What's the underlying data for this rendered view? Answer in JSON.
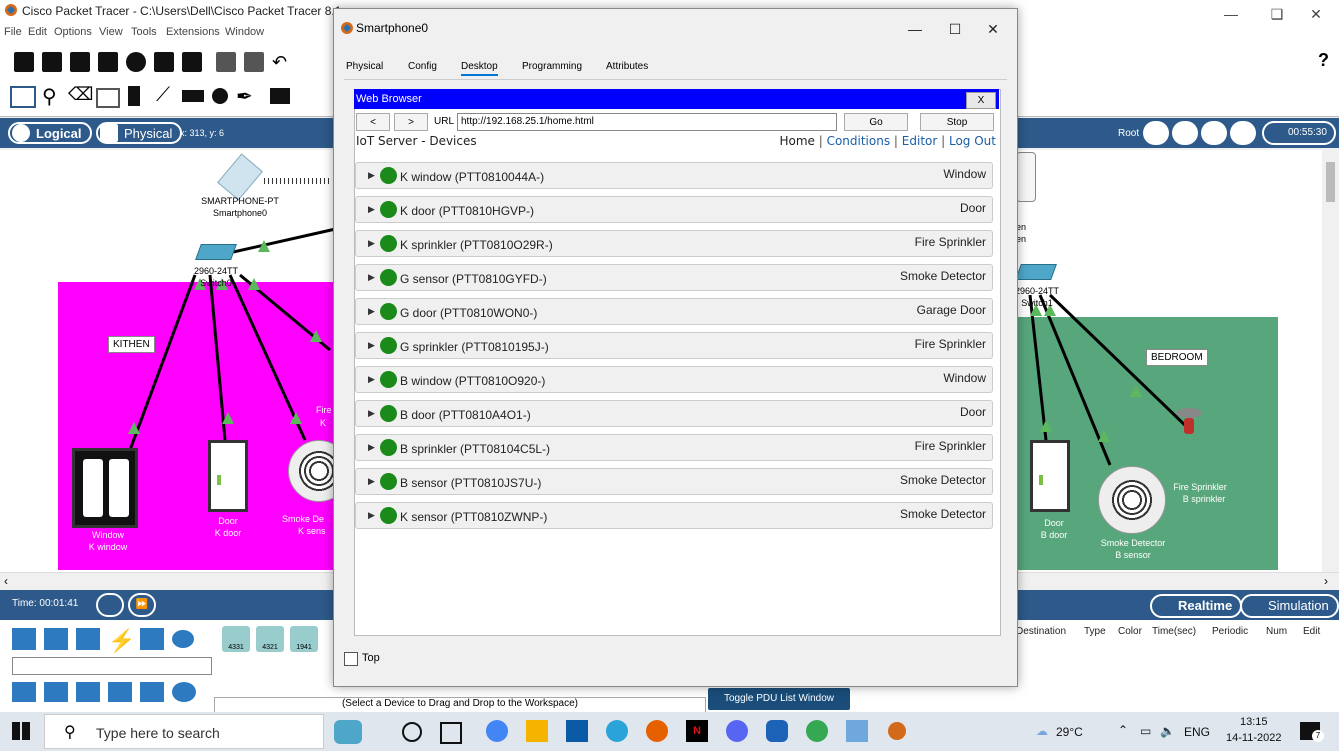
{
  "app": {
    "title": "Cisco Packet Tracer - C:\\Users\\Dell\\Cisco Packet Tracer 8.1.",
    "menu": [
      "File",
      "Edit",
      "Options",
      "View",
      "Tools",
      "Extensions",
      "Window"
    ],
    "coords": "x: 313, y: 6",
    "logical_label": "Logical",
    "physical_label": "Physical",
    "root_label": "Root",
    "clock": "00:55:30",
    "help": "?"
  },
  "workspace": {
    "smartphone_label1": "SMARTPHONE-PT",
    "smartphone_label2": "Smartphone0",
    "switch_left_label1": "2960-24TT",
    "switch_left_label2": "Switch0",
    "switch_right_label1": "2960-24TT",
    "switch_right_label2": "Switch1",
    "kitchen_label": "KITHEN",
    "bedroom_label": "BEDROOM",
    "k_window_label1": "Window",
    "k_window_label2": "K window",
    "k_door_label1": "Door",
    "k_door_label2": "K door",
    "k_smoke_label1": "Smoke De",
    "k_smoke_label2": "K sens",
    "k_fire_label1": "Fire",
    "k_fire_label2": "K",
    "b_door_label1": "Door",
    "b_door_label2": "B door",
    "b_smoke_label1": "Smoke Detector",
    "b_smoke_label2": "B sensor",
    "b_fire_label1": "Fire Sprinkler",
    "b_fire_label2": "B sprinkler",
    "right_partial1": "en",
    "right_partial2": "en"
  },
  "bottom": {
    "time": "Time: 00:01:41",
    "realtime": "Realtime",
    "simulation": "Simulation",
    "status": "(Select a Device to Drag and Drop to the Workspace)",
    "toggle_pdu": "Toggle PDU List Window",
    "pdu_headers": [
      "Destination",
      "Type",
      "Color",
      "Time(sec)",
      "Periodic",
      "Num",
      "Edit"
    ],
    "models": [
      "4331",
      "4321",
      "1941"
    ]
  },
  "taskbar": {
    "search_placeholder": "Type here to search",
    "weather": "29°C",
    "lang": "ENG",
    "time": "13:15",
    "date": "14-11-2022",
    "notif_count": "7"
  },
  "dialog": {
    "title": "Smartphone0",
    "tabs": [
      "Physical",
      "Config",
      "Desktop",
      "Programming",
      "Attributes"
    ],
    "active_tab": "Desktop",
    "web_browser_title": "Web Browser",
    "close_x": "X",
    "back": "<",
    "forward": ">",
    "url_label": "URL",
    "url": "http://192.168.25.1/home.html",
    "go": "Go",
    "stop": "Stop",
    "page_title": "IoT Server - Devices",
    "nav": {
      "home": "Home",
      "conditions": "Conditions",
      "editor": "Editor",
      "logout": "Log Out"
    },
    "devices": [
      {
        "name": "K window (PTT0810044A-)",
        "type": "Window"
      },
      {
        "name": "K door (PTT0810HGVP-)",
        "type": "Door"
      },
      {
        "name": "K sprinkler (PTT0810O29R-)",
        "type": "Fire Sprinkler"
      },
      {
        "name": "G sensor (PTT0810GYFD-)",
        "type": "Smoke Detector"
      },
      {
        "name": "G door (PTT0810WON0-)",
        "type": "Garage Door"
      },
      {
        "name": "G sprinkler (PTT0810195J-)",
        "type": "Fire Sprinkler"
      },
      {
        "name": "B window (PTT0810O920-)",
        "type": "Window"
      },
      {
        "name": "B door (PTT0810A4O1-)",
        "type": "Door"
      },
      {
        "name": "B sprinkler (PTT08104C5L-)",
        "type": "Fire Sprinkler"
      },
      {
        "name": "B sensor (PTT0810JS7U-)",
        "type": "Smoke Detector"
      },
      {
        "name": "K sensor (PTT0810ZWNP-)",
        "type": "Smoke Detector"
      }
    ],
    "top_label": "Top"
  },
  "colors": {
    "kitchen": "#ff00ff",
    "bedroom": "#58a67c",
    "webbar": "#0000ff",
    "status_dot": "#1a8a1a"
  }
}
